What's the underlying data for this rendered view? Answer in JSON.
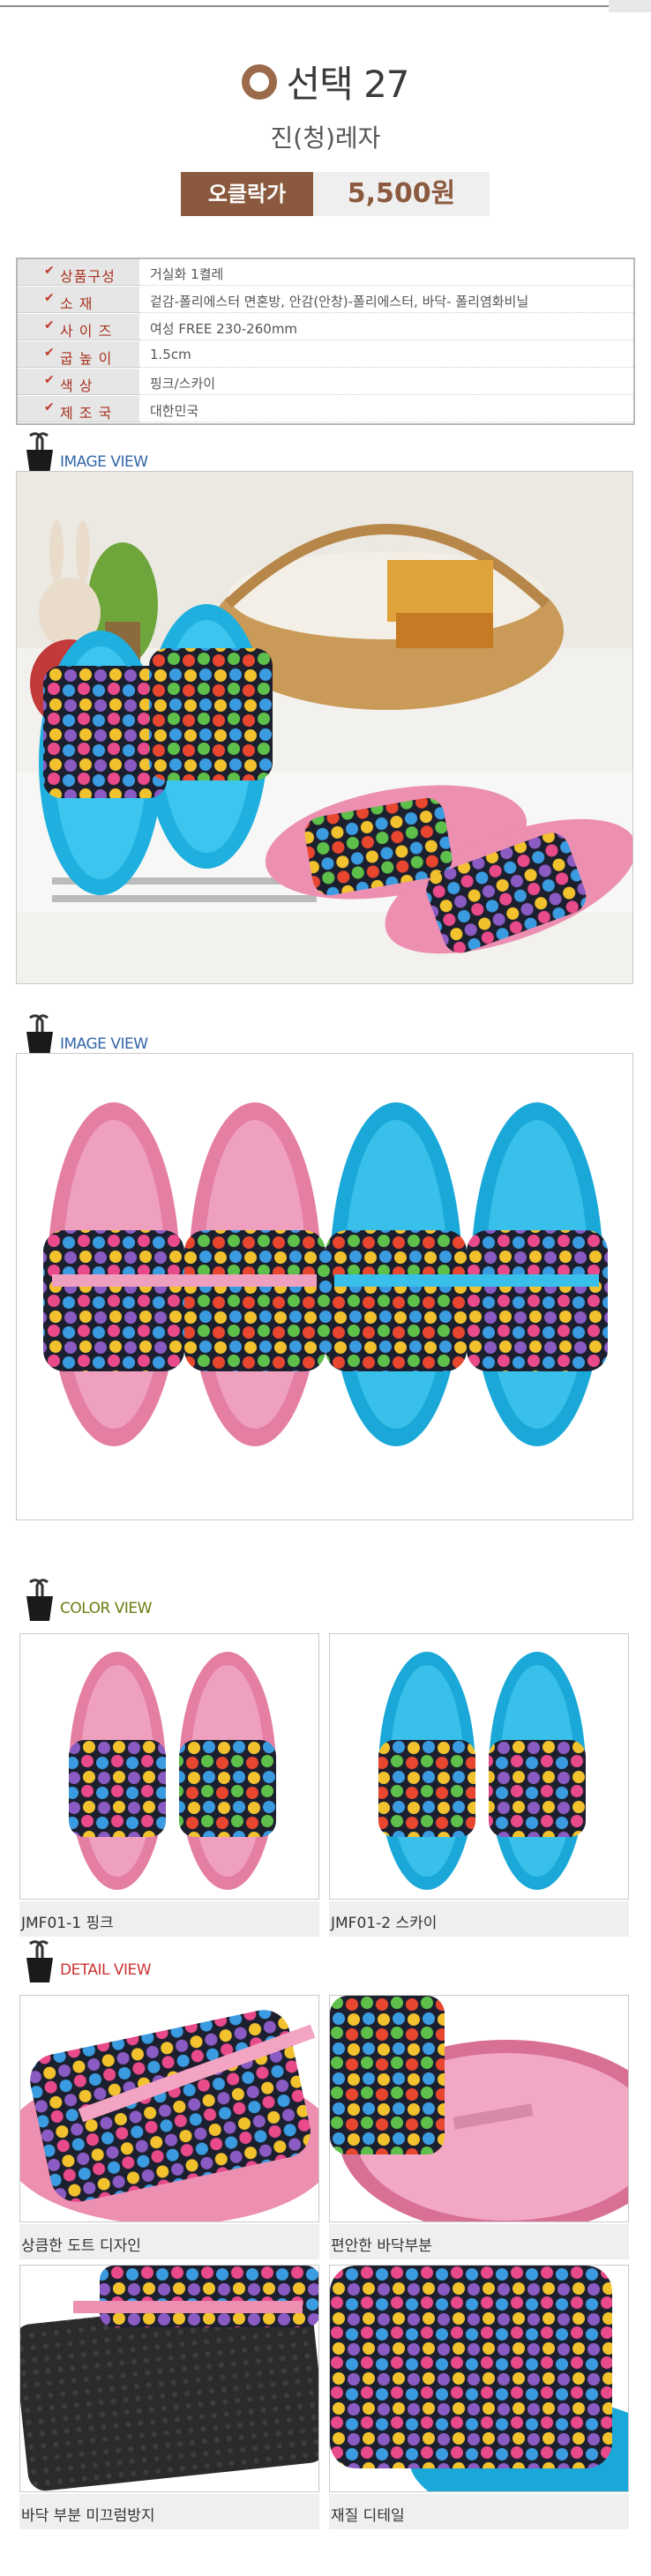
{
  "header": {
    "title": "선택 27",
    "subtitle": "진(청)레자",
    "price_label": "오클락가",
    "price_value": "5,500원"
  },
  "spec": [
    {
      "key": "상품구성",
      "value": "거실화 1켤레"
    },
    {
      "key": "소      재",
      "value": "겉감-폴리에스터 면혼방, 안감(안창)-폴리에스터, 바닥- 폴리염화비닐"
    },
    {
      "key": "사 이 즈",
      "value": "여성 FREE 230-260mm"
    },
    {
      "key": "굽 높 이",
      "value": "1.5cm"
    },
    {
      "key": "색      상",
      "value": "핑크/스카이"
    },
    {
      "key": "제 조 국",
      "value": "대한민국"
    }
  ],
  "sections": {
    "image_view_1": "IMAGE VIEW",
    "image_view_2": "IMAGE VIEW",
    "color_view": "COLOR VIEW",
    "detail_view": "DETAIL VIEW"
  },
  "color_items": [
    {
      "caption": "JMF01-1 핑크"
    },
    {
      "caption": "JMF01-2 스카이"
    }
  ],
  "detail_items": [
    {
      "caption": "상큼한 도트 디자인"
    },
    {
      "caption": "편안한 바닥부분"
    },
    {
      "caption": "바닥 부분 미끄럼방지"
    },
    {
      "caption": "재질 디테일"
    }
  ],
  "colors": {
    "brown": "#8b5a3e",
    "pink": "#ec8fb0",
    "sky": "#1fb0df",
    "fabric": "#1c1f2e"
  }
}
